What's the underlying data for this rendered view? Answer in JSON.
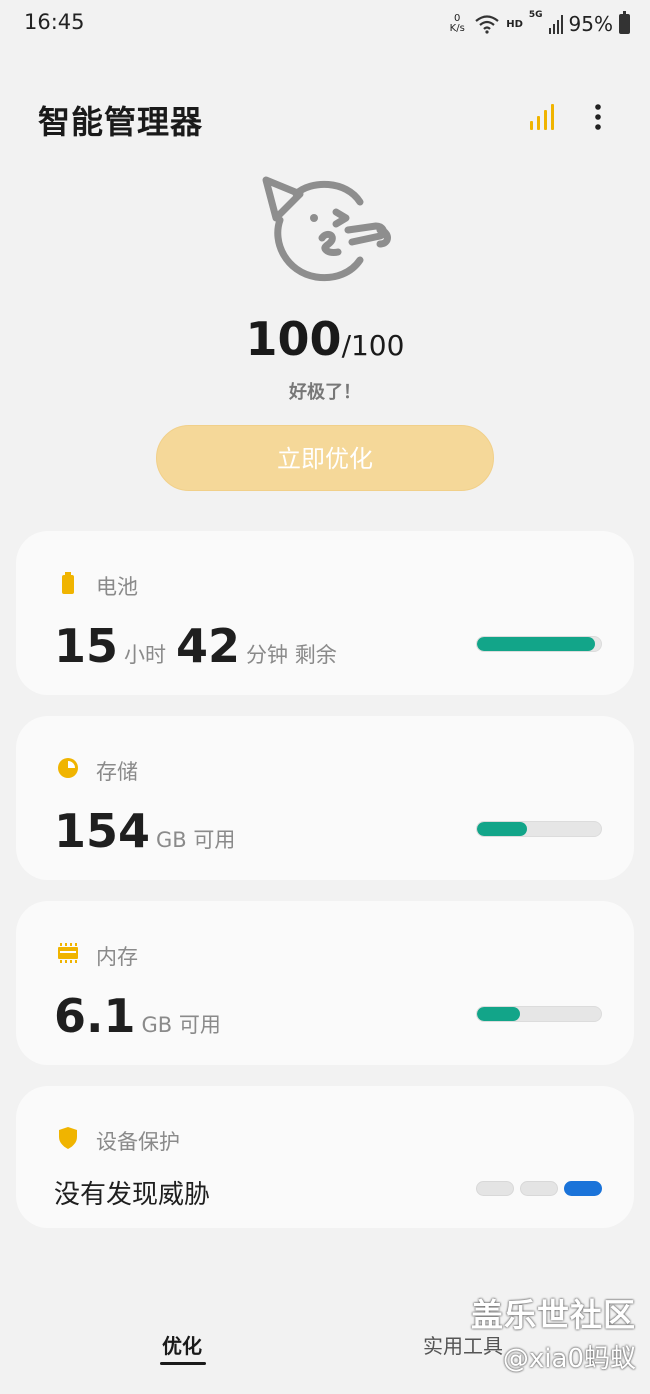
{
  "status_bar": {
    "time": "16:45",
    "net_speed_value": "0",
    "net_speed_unit": "K/s",
    "hd_label": "HD",
    "network_label": "5G",
    "battery_percent": "95%"
  },
  "header": {
    "title": "智能管理器"
  },
  "hero": {
    "score": "100",
    "score_max": "/100",
    "status": "好极了！",
    "optimize_button": "立即优化"
  },
  "battery": {
    "label": "电池",
    "hours": "15",
    "hours_unit": "小时",
    "minutes": "42",
    "minutes_unit": "分钟 剩余",
    "level_fraction": 0.95
  },
  "storage": {
    "label": "存储",
    "value": "154",
    "unit": "GB 可用",
    "used_fraction": 0.4
  },
  "memory": {
    "label": "内存",
    "value": "6.1",
    "unit": "GB 可用",
    "used_fraction": 0.35
  },
  "protection": {
    "label": "设备保护",
    "status": "没有发现威胁",
    "active_level": 3
  },
  "bottom_nav": {
    "tabs": [
      {
        "label": "优化"
      },
      {
        "label": "实用工具"
      }
    ]
  },
  "watermark": {
    "title": "盖乐世社区",
    "user": "@xia0蚂蚁"
  },
  "colors": {
    "accent_yellow": "#f0b400",
    "bar_green": "#12a589",
    "protection_blue": "#1a73d9"
  },
  "icons": {
    "signal": "signal-bars-icon",
    "wifi": "wifi-icon",
    "chart": "bar-chart-icon",
    "more": "more-vertical-icon",
    "mascot": "party-face-icon",
    "battery": "battery-icon",
    "storage": "pie-icon",
    "memory": "chip-icon",
    "protection": "shield-icon"
  }
}
